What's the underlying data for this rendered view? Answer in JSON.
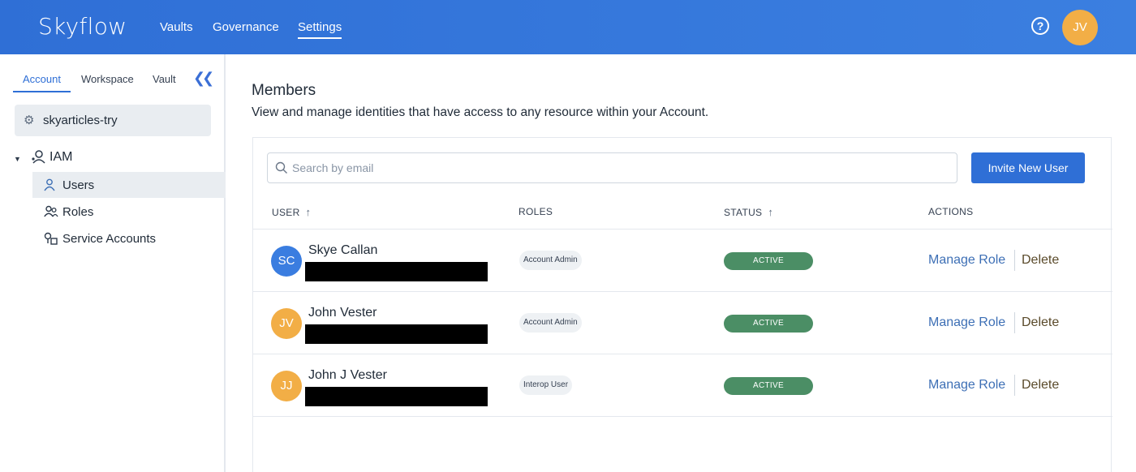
{
  "brand": {
    "logo": "Skyflow"
  },
  "topnav": {
    "items": [
      {
        "label": "Vaults"
      },
      {
        "label": "Governance"
      },
      {
        "label": "Settings"
      }
    ],
    "active": "Settings",
    "help_icon": "?",
    "user_initials": "JV"
  },
  "sidebar": {
    "tabs": [
      {
        "label": "Account"
      },
      {
        "label": "Workspace"
      },
      {
        "label": "Vault"
      }
    ],
    "active_tab": "Account",
    "collapse_icon": "chevron-double-left-icon",
    "account_name": "skyarticles-try",
    "group": {
      "label": "IAM",
      "expanded": true
    },
    "items": [
      {
        "label": "Users",
        "icon": "user-icon",
        "active": true
      },
      {
        "label": "Roles",
        "icon": "users-icon",
        "active": false
      },
      {
        "label": "Service Accounts",
        "icon": "service-accounts-icon",
        "active": false
      }
    ]
  },
  "main": {
    "title": "Members",
    "subtitle": "View and manage identities that have access to any resource within your Account.",
    "search": {
      "placeholder": "Search by email",
      "value": ""
    },
    "invite_label": "Invite New User",
    "columns": {
      "user": "USER",
      "roles": "ROLES",
      "status": "STATUS",
      "actions": "ACTIONS"
    },
    "rows": [
      {
        "initials": "SC",
        "avatar_color": "#3a7de0",
        "name": "Skye Callan",
        "role": "Account Admin",
        "status": "ACTIVE",
        "manage": "Manage Role",
        "delete": "Delete"
      },
      {
        "initials": "JV",
        "avatar_color": "#f2ae46",
        "name": "John Vester",
        "role": "Account Admin",
        "status": "ACTIVE",
        "manage": "Manage Role",
        "delete": "Delete"
      },
      {
        "initials": "JJ",
        "avatar_color": "#f2ae46",
        "name": "John J Vester",
        "role": "Interop User",
        "status": "ACTIVE",
        "manage": "Manage Role",
        "delete": "Delete"
      }
    ]
  },
  "colors": {
    "primary": "#2f6fd6",
    "status_active": "#4b8e65",
    "link": "#3d6fb5"
  }
}
